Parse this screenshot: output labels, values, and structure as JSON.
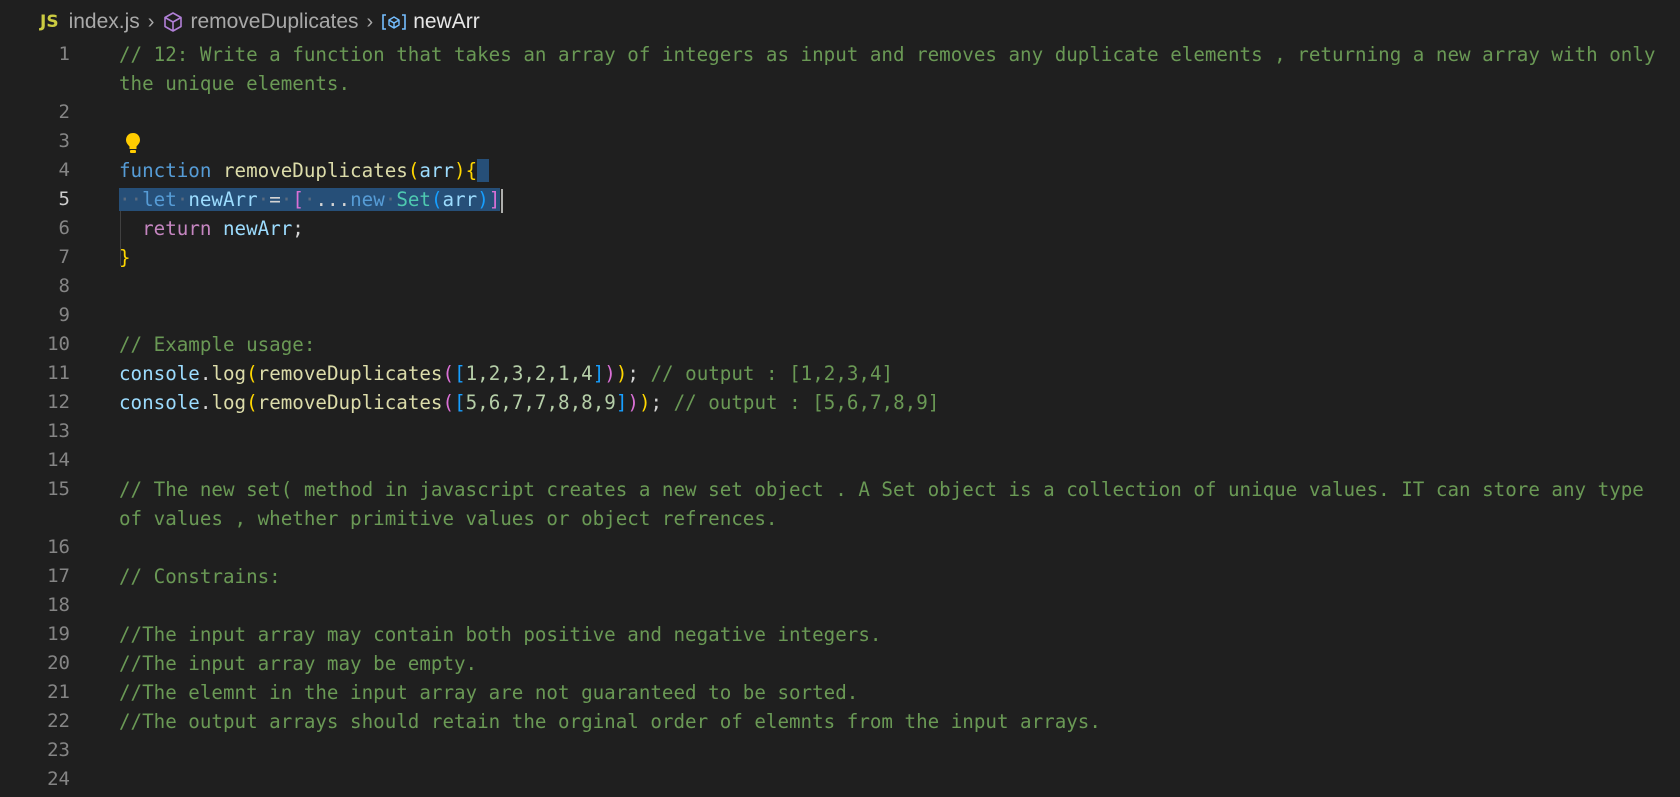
{
  "breadcrumb": {
    "lang_badge": "JS",
    "file": "index.js",
    "symbol": "removeDuplicates",
    "variable": "newArr",
    "symbol_icon": "cube-icon",
    "variable_icon": "variable-icon"
  },
  "lines": {
    "n1": "1",
    "n2": "2",
    "n3": "3",
    "n4": "4",
    "n5": "5",
    "n6": "6",
    "n7": "7",
    "n8": "8",
    "n9": "9",
    "n10": "10",
    "n11": "11",
    "n12": "12",
    "n13": "13",
    "n14": "14",
    "n15": "15",
    "n16": "16",
    "n17": "17",
    "n18": "18",
    "n19": "19",
    "n20": "20",
    "n21": "21",
    "n22": "22",
    "n23": "23",
    "n24": "24"
  },
  "code": {
    "l1": "// 12: Write a function that takes an array of integers as input and removes any duplicate elements , returning a new array with only the unique elements.",
    "l4_kw": "function",
    "l4_fn": "removeDuplicates",
    "l4_param": "arr",
    "l5_kw": "let",
    "l5_var": "newArr",
    "l5_eq": "=",
    "l5_spread": "...",
    "l5_new": "new",
    "l5_cls": "Set",
    "l5_arg": "arr",
    "l6_kw": "return",
    "l6_var": "newArr",
    "l6_semi": ";",
    "l10": "// Example usage:",
    "l11_obj": "console",
    "l11_fn": "log",
    "l11_inner": "removeDuplicates",
    "l11_nums": "1,2,3,2,1,4",
    "l11_cmt": "// output : [1,2,3,4]",
    "l12_obj": "console",
    "l12_fn": "log",
    "l12_inner": "removeDuplicates",
    "l12_nums": "5,6,7,7,8,8,9",
    "l12_cmt": "// output : [5,6,7,8,9]",
    "l15": "// The new set( method in javascript creates a new set object . A Set object is a collection of unique values. IT can store any type of values , whether primitive values or object refrences.",
    "l17": "// Constrains:",
    "l19": "//The input array may contain both positive and negative integers.",
    "l20": "//The input array may be empty.",
    "l21": "//The elemnt in the input array are not guaranteed to be sorted.",
    "l22": "//The output arrays should retain the orginal order of elemnts from the input arrays."
  },
  "colors": {
    "background": "#1f1f1f",
    "comment": "#6a9955",
    "keyword": "#569cd6",
    "function": "#dcdcaa",
    "variable": "#9cdcfe",
    "selection": "#264f78"
  }
}
